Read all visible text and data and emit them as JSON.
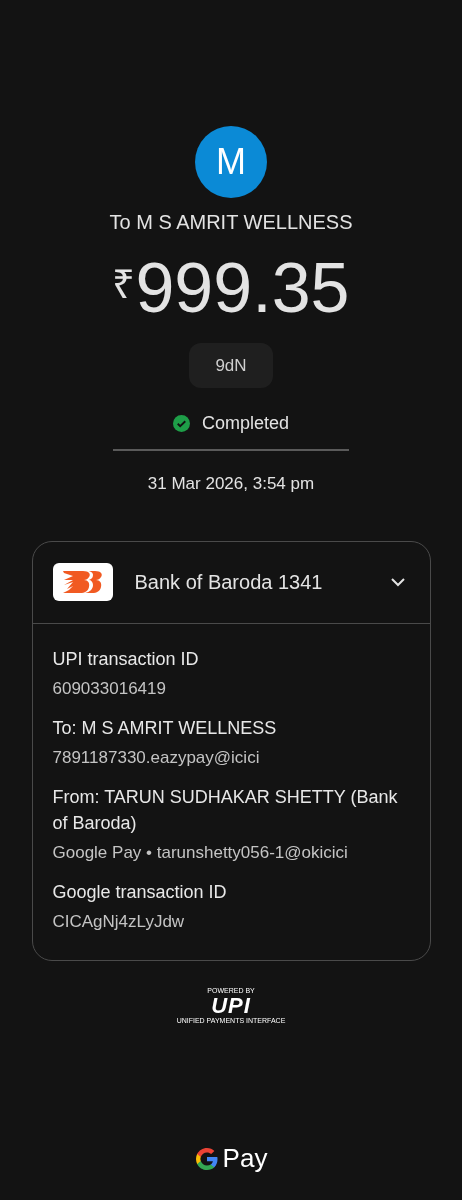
{
  "payee": {
    "avatar_letter": "M",
    "title": "To M S AMRIT WELLNESS"
  },
  "amount": {
    "currency": "₹",
    "value": "999.35"
  },
  "note": "9dN",
  "status": {
    "kind": "completed",
    "label": "Completed"
  },
  "date": "31 Mar 2026, 3:54 pm",
  "account": {
    "name": "Bank of Baroda 1341",
    "expanded": true
  },
  "details": [
    {
      "label": "UPI transaction ID",
      "value": "609033016419"
    },
    {
      "label": "To: M S AMRIT WELLNESS",
      "value": "7891187330.eazypay@icici"
    },
    {
      "label": "From: TARUN SUDHAKAR SHETTY (Bank of Baroda)",
      "value": "Google Pay • tarunshetty056-1@okicici"
    },
    {
      "label": "Google transaction ID",
      "value": "CICAgNj4zLyJdw"
    }
  ],
  "upi_badge": {
    "top": "POWERED BY",
    "mark": "UPI",
    "bottom": "UNIFIED PAYMENTS INTERFACE"
  },
  "footer": {
    "brand": "Pay"
  }
}
